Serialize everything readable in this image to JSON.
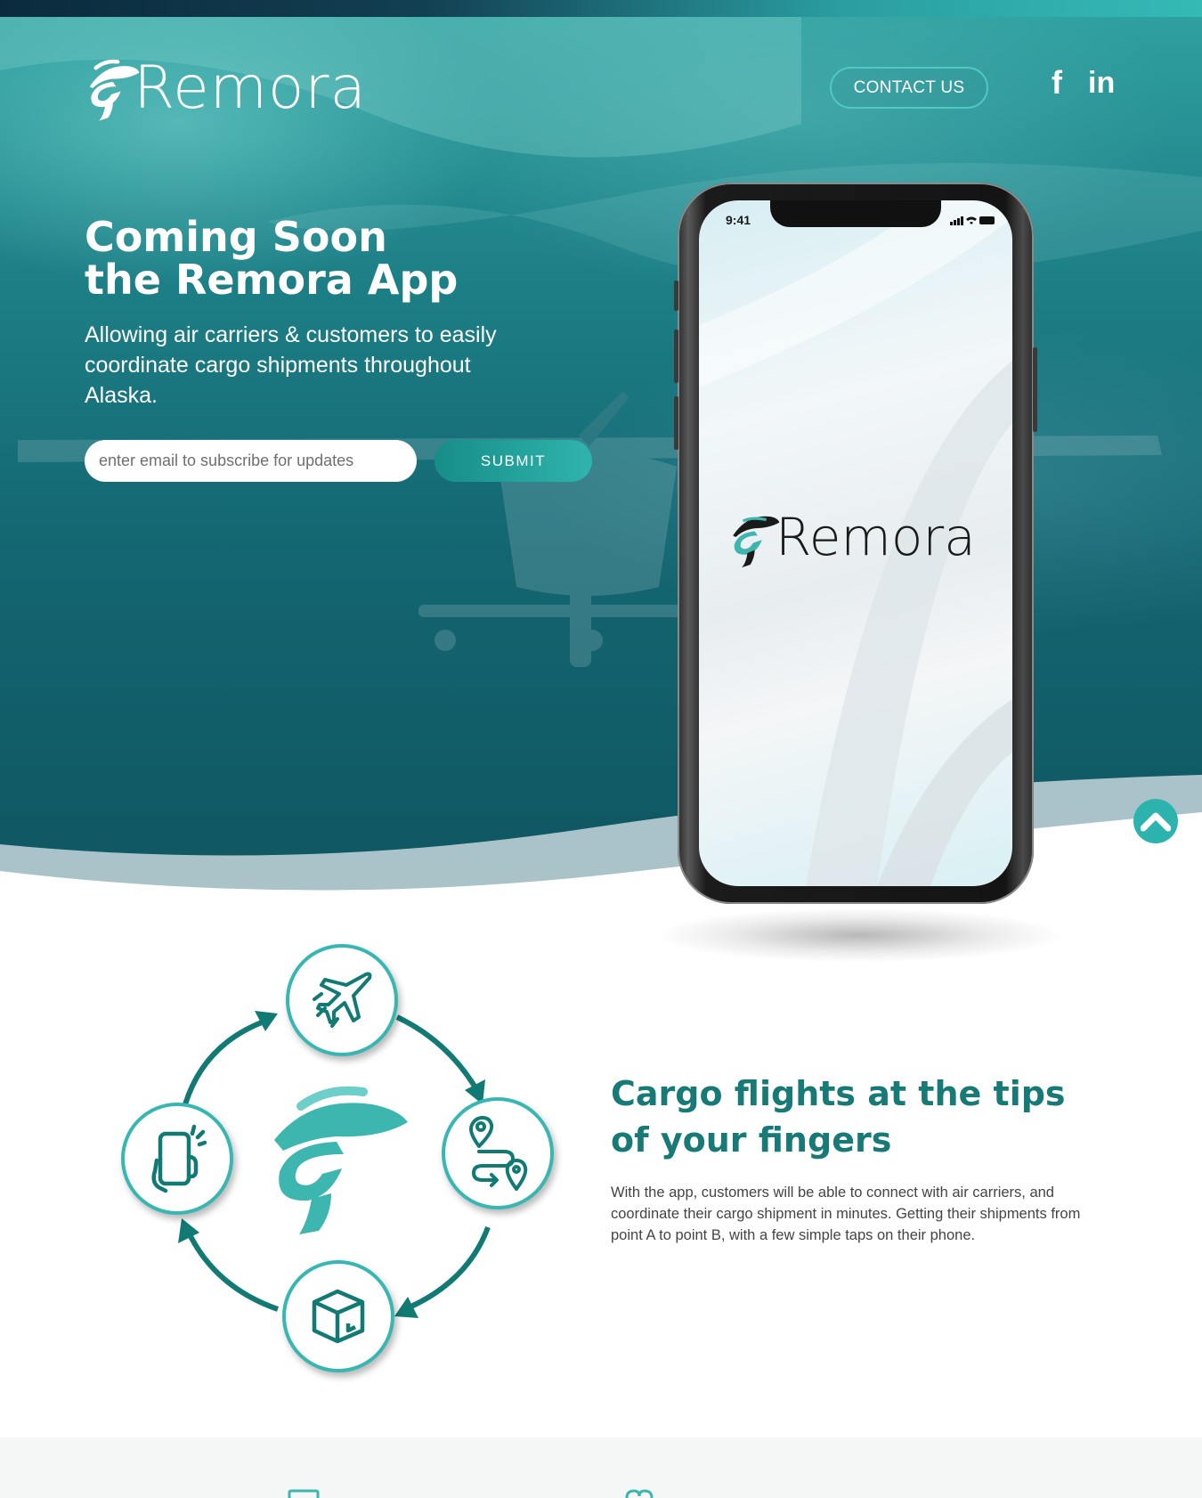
{
  "brand": {
    "name": "Remora",
    "accent": "#2fb4ad",
    "dark_accent": "#177a77"
  },
  "header": {
    "contact_label": "CONTACT US",
    "social": [
      {
        "name": "facebook-icon",
        "glyph": "f"
      },
      {
        "name": "linkedin-icon",
        "glyph": "in"
      }
    ]
  },
  "hero": {
    "headline_line1": "Coming Soon",
    "headline_line2": "the Remora App",
    "subhead": "Allowing air carriers & customers to easily coordinate cargo shipments throughout Alaska.",
    "email_placeholder": "enter email to subscribe for updates",
    "submit_label": "SUBMIT"
  },
  "phone": {
    "time": "9:41",
    "app_name": "Remora"
  },
  "feature": {
    "title": "Cargo flights at the tips of your fingers",
    "body": "With the app, customers will be able to connect with air carriers, and coordinate their cargo shipment in minutes. Getting their shipments from point A to point B, with a few simple taps on their phone.",
    "cycle_icons": [
      "airplane-icon",
      "route-pin-icon",
      "package-icon",
      "phone-tap-icon"
    ]
  }
}
